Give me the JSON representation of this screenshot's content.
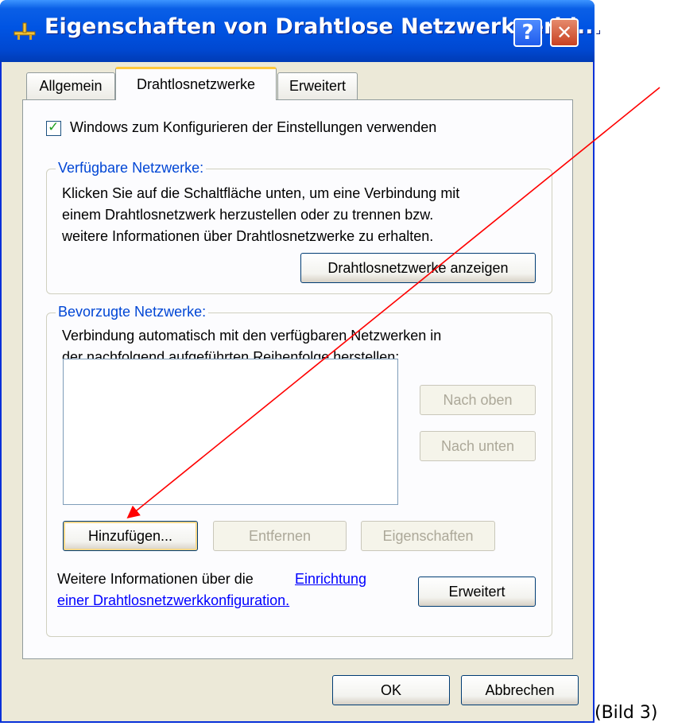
{
  "window": {
    "title": "Eigenschaften von Drahtlose Netzwerkverbi...",
    "help_glyph": "?",
    "close_glyph": "✕"
  },
  "tabs": [
    {
      "label": "Allgemein",
      "active": false
    },
    {
      "label": "Drahtlosnetzwerke",
      "active": true
    },
    {
      "label": "Erweitert",
      "active": false
    }
  ],
  "config_checkbox": {
    "checked": true,
    "label": "Windows zum Konfigurieren der Einstellungen verwenden",
    "check_glyph": "✓"
  },
  "available_networks": {
    "legend": "Verfügbare Netzwerke:",
    "description_lines": [
      "Klicken Sie auf die Schaltfläche unten, um eine Verbindung mit",
      "einem Drahtlosnetzwerk herzustellen oder zu trennen bzw.",
      "weitere Informationen über Drahtlosnetzwerke zu erhalten."
    ],
    "show_button": "Drahtlosnetzwerke anzeigen"
  },
  "preferred_networks": {
    "legend": "Bevorzugte Netzwerke:",
    "description_lines": [
      "Verbindung automatisch mit den verfügbaren Netzwerken in",
      "der nachfolgend aufgeführten Reihenfolge herstellen:"
    ],
    "move_up_button": "Nach oben",
    "move_down_button": "Nach unten",
    "add_button": "Hinzufügen...",
    "remove_button": "Entfernen",
    "properties_button": "Eigenschaften"
  },
  "info": {
    "prefix": "Weitere Informationen über die",
    "link_line1": "Einrichtung",
    "link_line2": "einer Drahtlosnetzwerkkonfiguration.",
    "advanced_button": "Erweitert"
  },
  "footer": {
    "ok_button": "OK",
    "cancel_button": "Abbrechen"
  },
  "caption": "(Bild 3)",
  "colors": {
    "annotation_arrow": "#ff0000",
    "titlebar": "#0054e3",
    "legend_text": "#0046d5",
    "link_text": "#0000ff"
  }
}
